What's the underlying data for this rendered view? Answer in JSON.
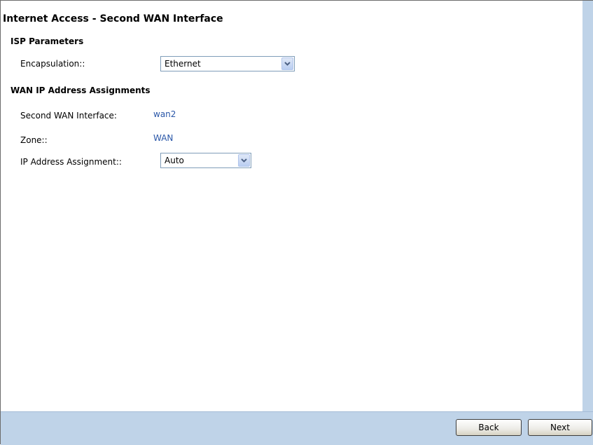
{
  "page": {
    "title": "Internet Access - Second WAN Interface"
  },
  "isp_parameters": {
    "heading": "ISP Parameters",
    "encapsulation": {
      "label": "Encapsulation::",
      "selected": "Ethernet"
    }
  },
  "wan_ip": {
    "heading": "WAN IP Address Assignments",
    "second_wan_interface": {
      "label": "Second WAN Interface:",
      "value": "wan2"
    },
    "zone": {
      "label": "Zone::",
      "value": "WAN"
    },
    "ip_address_assignment": {
      "label": "IP Address Assignment::",
      "selected": "Auto"
    }
  },
  "footer": {
    "back_label": "Back",
    "next_label": "Next"
  },
  "colors": {
    "accent_panel": "#bfd3e8",
    "value_text": "#2a57a8"
  },
  "icons": {
    "dropdown": "chevron-down-icon"
  }
}
